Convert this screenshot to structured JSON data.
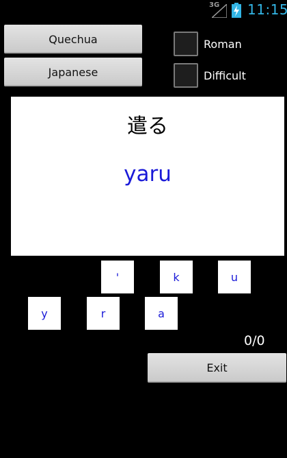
{
  "status_bar": {
    "network": "3G",
    "time": "11:15",
    "time_color": "#33b5e5"
  },
  "language_buttons": {
    "source": "Quechua",
    "target": "Japanese"
  },
  "options": {
    "roman_label": "Roman",
    "roman_checked": false,
    "difficult_label": "Difficult",
    "difficult_checked": false
  },
  "card": {
    "word": "遣る",
    "romanization": "yaru",
    "romanization_color": "#1a1ad8"
  },
  "letter_tiles": [
    "'",
    "k",
    "u",
    "y",
    "r",
    "a"
  ],
  "score": "0/0",
  "exit_label": "Exit"
}
